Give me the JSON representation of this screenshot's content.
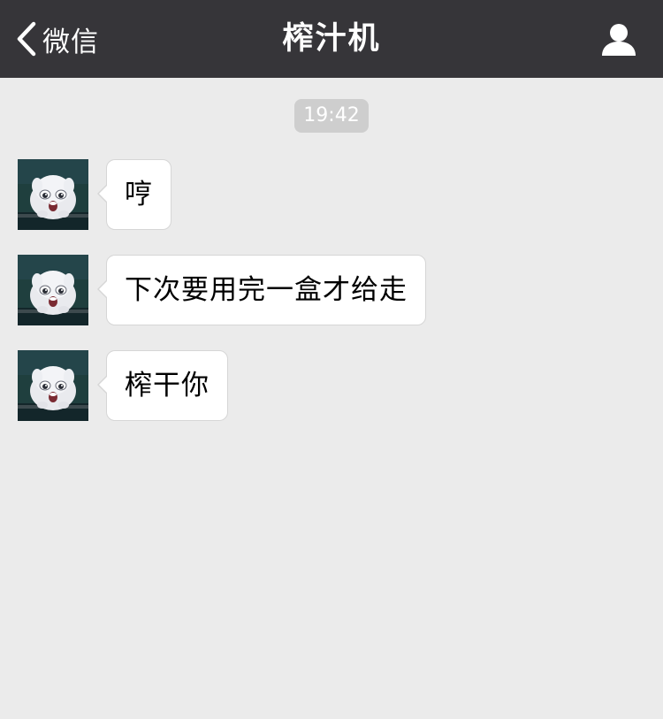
{
  "nav": {
    "back_label": "微信",
    "title": "榨汁机",
    "back_icon": "chevron-left-icon",
    "profile_icon": "person-icon"
  },
  "chat": {
    "timestamp": "19:42",
    "messages": [
      {
        "text": "哼"
      },
      {
        "text": "下次要用完一盒才给走"
      },
      {
        "text": "榨干你"
      }
    ]
  },
  "colors": {
    "nav_background": "#363539",
    "chat_background": "#ebebeb",
    "bubble_background": "#ffffff",
    "timestamp_background": "#cecece"
  }
}
